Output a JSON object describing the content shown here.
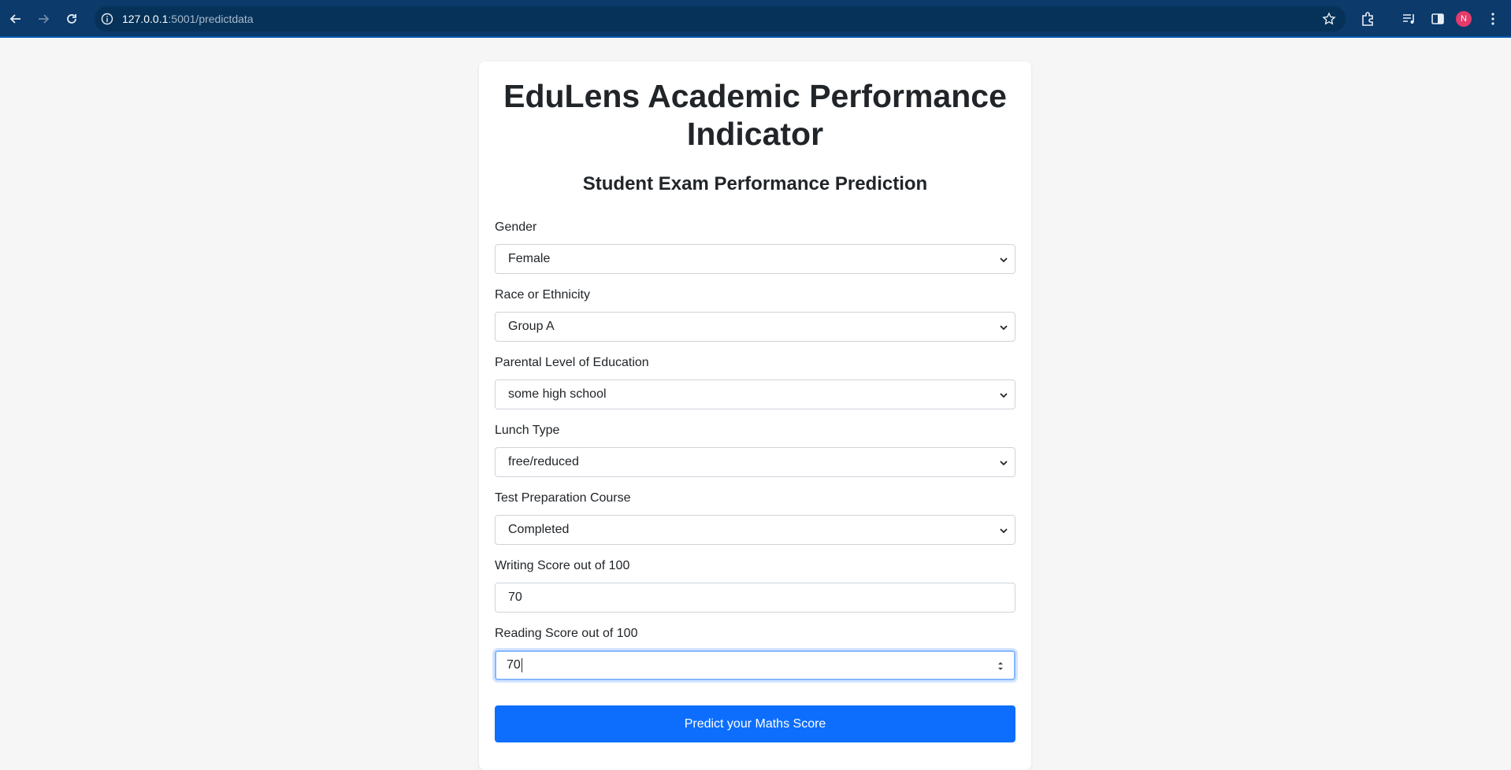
{
  "browser": {
    "url_host": "127.0.0.1",
    "url_path": ":5001/predictdata",
    "profile_initial": "N"
  },
  "page": {
    "title": "EduLens Academic Performance Indicator",
    "subtitle": "Student Exam Performance Prediction"
  },
  "form": {
    "gender": {
      "label": "Gender",
      "value": "Female"
    },
    "ethnicity": {
      "label": "Race or Ethnicity",
      "value": "Group A"
    },
    "parental_education": {
      "label": "Parental Level of Education",
      "value": "some high school"
    },
    "lunch": {
      "label": "Lunch Type",
      "value": "free/reduced"
    },
    "test_prep": {
      "label": "Test Preparation Course",
      "value": "Completed"
    },
    "writing_score": {
      "label": "Writing Score out of 100",
      "value": "70"
    },
    "reading_score": {
      "label": "Reading Score out of 100",
      "value": "70"
    },
    "submit_label": "Predict your Maths Score"
  },
  "colors": {
    "chrome_bg": "#0b3a6b",
    "primary": "#0d6efd"
  }
}
